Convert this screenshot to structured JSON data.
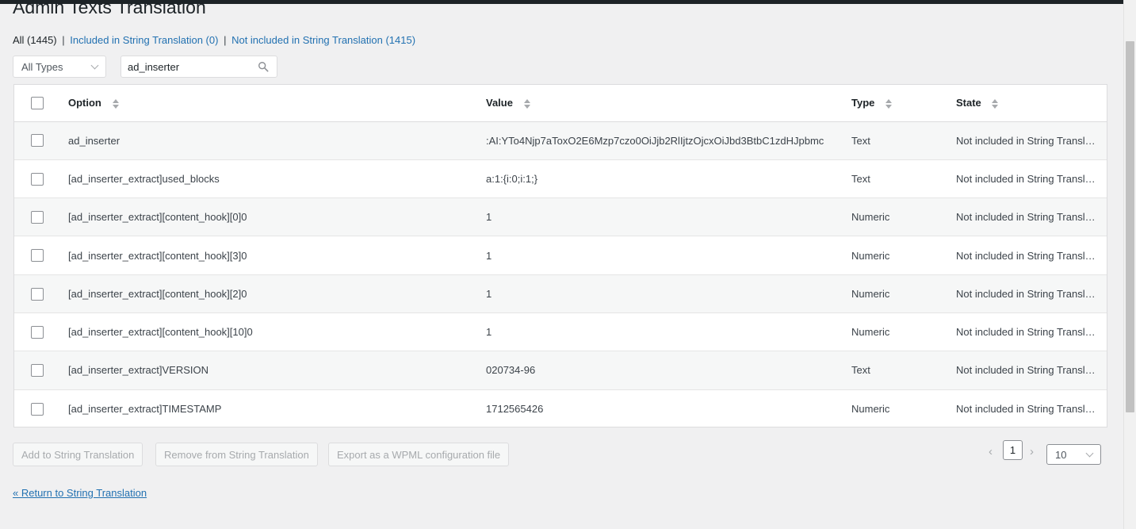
{
  "page": {
    "title": "Admin Texts Translation"
  },
  "filters": {
    "all": "All (1445)",
    "separator": "|",
    "included": "Included in String Translation (0)",
    "not_included": "Not included in String Translation (1415)"
  },
  "type_select": {
    "value": "All Types"
  },
  "search": {
    "value": "ad_inserter",
    "placeholder": ""
  },
  "table": {
    "headers": {
      "option": "Option",
      "value": "Value",
      "type": "Type",
      "state": "State"
    },
    "rows": [
      {
        "option": "ad_inserter",
        "value": ":AI:YTo4Njp7aToxO2E6Mzp7czo0OiJjb2RlIjtzOjcxOiJbd3BtbC1zdHJpbmc",
        "type": "Text",
        "state": "Not included in String Translation"
      },
      {
        "option": "[ad_inserter_extract]used_blocks",
        "value": "a:1:{i:0;i:1;}",
        "type": "Text",
        "state": "Not included in String Translation"
      },
      {
        "option": "[ad_inserter_extract][content_hook][0]0",
        "value": "1",
        "type": "Numeric",
        "state": "Not included in String Translation"
      },
      {
        "option": "[ad_inserter_extract][content_hook][3]0",
        "value": "1",
        "type": "Numeric",
        "state": "Not included in String Translation"
      },
      {
        "option": "[ad_inserter_extract][content_hook][2]0",
        "value": "1",
        "type": "Numeric",
        "state": "Not included in String Translation"
      },
      {
        "option": "[ad_inserter_extract][content_hook][10]0",
        "value": "1",
        "type": "Numeric",
        "state": "Not included in String Translation"
      },
      {
        "option": "[ad_inserter_extract]VERSION",
        "value": "020734-96",
        "type": "Text",
        "state": "Not included in String Translation"
      },
      {
        "option": "[ad_inserter_extract]TIMESTAMP",
        "value": "1712565426",
        "type": "Numeric",
        "state": "Not included in String Translation"
      }
    ]
  },
  "actions": {
    "add": "Add to String Translation",
    "remove": "Remove from String Translation",
    "export": "Export as a WPML configuration file"
  },
  "pagination": {
    "prev": "‹",
    "next": "›",
    "current_page": "1",
    "per_page": "10"
  },
  "footer": {
    "return_link": "« Return to String Translation"
  },
  "icons": {
    "search": "search-icon",
    "sort": "sort-icon",
    "chevron": "chevron-down-icon"
  }
}
